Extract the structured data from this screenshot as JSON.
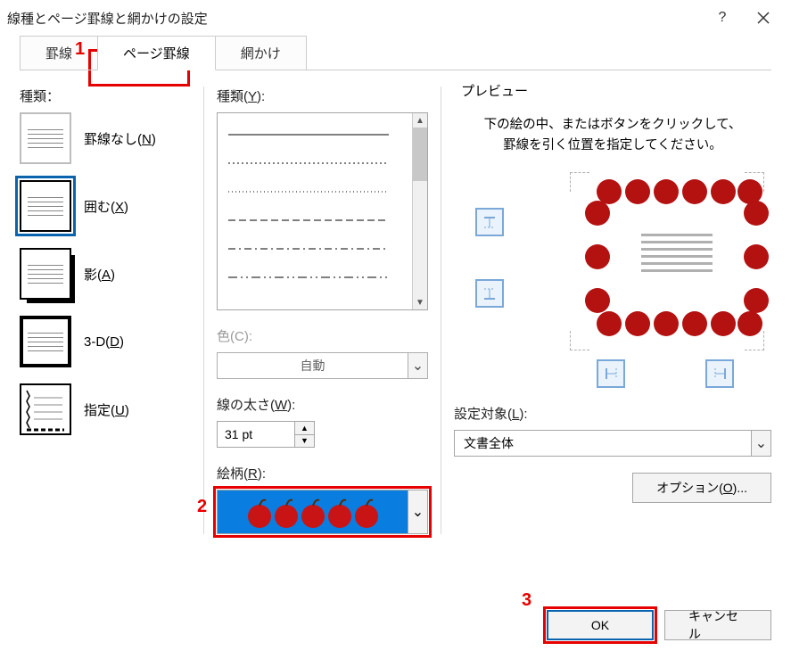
{
  "title": "線種とページ罫線と網かけの設定",
  "tabs": [
    "罫線",
    "ページ罫線",
    "網かけ"
  ],
  "activeTab": 1,
  "callouts": {
    "1": "1",
    "2": "2",
    "3": "3"
  },
  "left": {
    "label": "種類：",
    "items": [
      {
        "label": "罫線なし(",
        "mn": "N",
        "suffix": ")"
      },
      {
        "label": "囲む(",
        "mn": "X",
        "suffix": ")"
      },
      {
        "label": "影(",
        "mn": "A",
        "suffix": ")"
      },
      {
        "label": "3-D(",
        "mn": "D",
        "suffix": ")"
      },
      {
        "label": "指定(",
        "mn": "U",
        "suffix": ")"
      }
    ],
    "selected": 1
  },
  "mid": {
    "style_label": "種類(",
    "style_mn": "Y",
    "style_suffix": "):",
    "color_label_pre": "色(",
    "color_mn": "C",
    "color_suffix": "):",
    "color_value": "自動",
    "width_label": "線の太さ(",
    "width_mn": "W",
    "width_suffix": "):",
    "width_value": "31 pt",
    "art_label": "絵柄(",
    "art_mn": "R",
    "art_suffix": "):"
  },
  "right": {
    "preview_legend": "プレビュー",
    "preview_instr": "下の絵の中、またはボタンをクリックして、罫線を引く位置を指定してください。",
    "target_label": "設定対象(",
    "target_mn": "L",
    "target_suffix": "):",
    "target_value": "文書全体",
    "options_label": "オプション(",
    "options_mn": "O",
    "options_suffix": ")..."
  },
  "footer": {
    "ok": "OK",
    "cancel": "キャンセル"
  }
}
